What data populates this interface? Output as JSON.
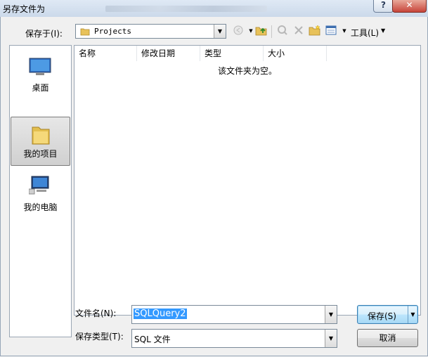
{
  "window": {
    "title": "另存文件为"
  },
  "toolbar": {
    "save_in_label": "保存于(I):",
    "location": "Projects",
    "tools_label": "工具(L)"
  },
  "places": [
    {
      "label": "桌面",
      "icon": "desktop-icon"
    },
    {
      "label": "我的项目",
      "icon": "folder-icon",
      "selected": true
    },
    {
      "label": "我的电脑",
      "icon": "computer-icon"
    }
  ],
  "file_list": {
    "columns": [
      "名称",
      "修改日期",
      "类型",
      "大小"
    ],
    "empty_message": "该文件夹为空。"
  },
  "filename": {
    "label": "文件名(N):",
    "value": "SQLQuery2"
  },
  "filetype": {
    "label": "保存类型(T):",
    "value": "SQL 文件"
  },
  "buttons": {
    "save": "保存(S)",
    "cancel": "取消"
  }
}
